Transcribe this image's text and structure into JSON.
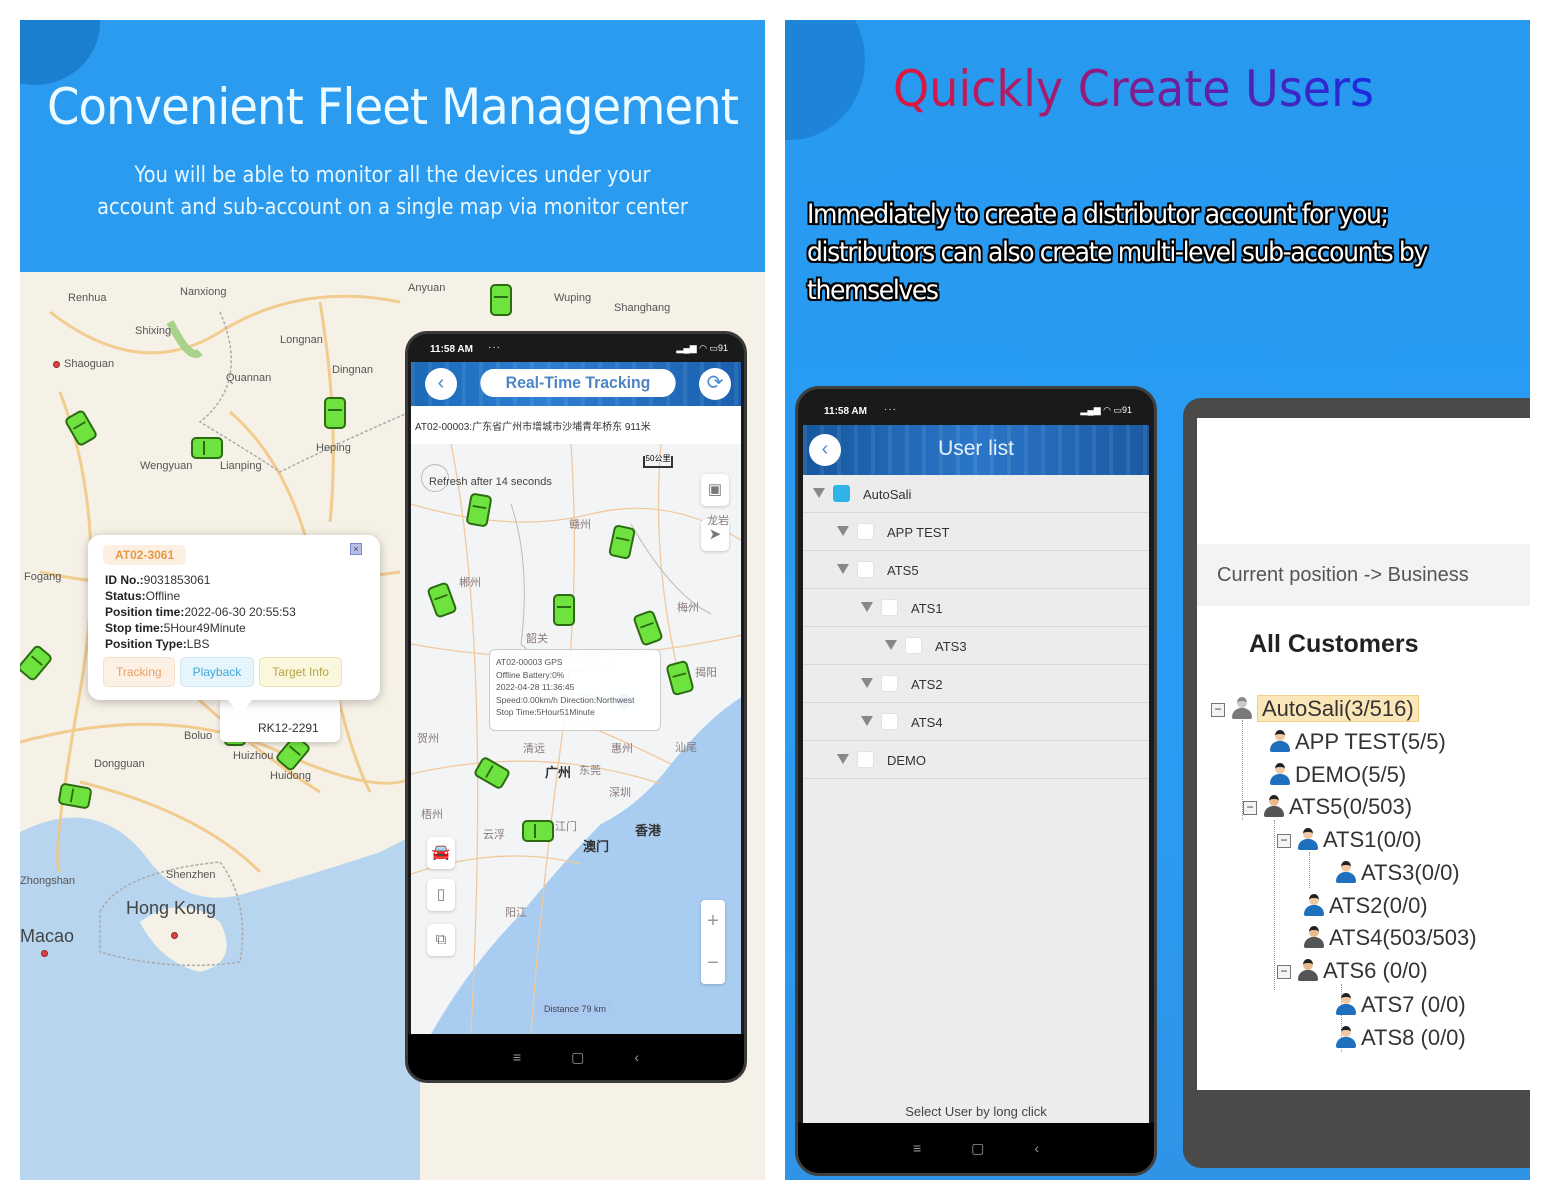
{
  "left": {
    "title": "Convenient Fleet Management",
    "subtitle_line1": "You will be able to monitor all the devices under your",
    "subtitle_line2": "account and sub-account on a single map via monitor center",
    "map_labels": [
      "Renhua",
      "Nanxiong",
      "Shixing",
      "Longnan",
      "Shaoguan",
      "Quannan",
      "Dingnan",
      "Heping",
      "Wengyuan",
      "Lianping",
      "Fogang",
      "Boluo",
      "Huizhou",
      "Huidong",
      "Dongguan",
      "Zhongshan",
      "Shenzhen",
      "Hong Kong",
      "Macao",
      "Anyuan",
      "Wuping",
      "Shanghang"
    ],
    "info_popup": {
      "device": "AT02-3061",
      "id_label": "ID No.:",
      "id_value": "9031853061",
      "status_label": "Status:",
      "status_value": "Offline",
      "position_time_label": "Position time:",
      "position_time_value": "2022-06-30 20:55:53",
      "stop_time_label": "Stop time:",
      "stop_time_value": "5Hour49Minute",
      "position_type_label": "Position Type:",
      "position_type_value": "LBS",
      "buttons": [
        "Tracking",
        "Playback",
        "Target Info"
      ]
    },
    "second_popup_text": "RK12-2291",
    "phone": {
      "time": "11:58 AM",
      "dots": "···",
      "battery": "91",
      "title": "Real-Time Tracking",
      "address": "AT02-00003:广东省广州市增城市沙埔青年桥东 911米",
      "refresh_text": "Refresh after 14 seconds",
      "scale": "50公里",
      "gps_popup": {
        "line1": "AT02-00003  GPS",
        "line2": "Offline Battery:0%",
        "line3": "2022-04-28 11:36:45",
        "line4": "Speed:0.00km/h Direction:Northwest",
        "line5": "Stop Time:5Hour51Minute"
      },
      "map_labels": [
        "赣州",
        "郴州",
        "龙岩",
        "梅州",
        "韶关",
        "清远",
        "惠州",
        "汕尾",
        "广州",
        "东莞",
        "深圳",
        "香港",
        "澳门",
        "江门",
        "云浮",
        "梧州",
        "阳江",
        "贺州",
        "揭阳"
      ],
      "distance": "Distance 79 km",
      "zoom_in": "+",
      "zoom_out": "−"
    }
  },
  "right": {
    "title": "Quickly Create Users",
    "description": "Immediately to create a distributor account for you; distributors can also create multi-level sub-accounts by themselves",
    "phone": {
      "time": "11:58 AM",
      "dots": "···",
      "battery": "91",
      "title": "User list",
      "users": [
        {
          "name": "AutoSali",
          "level": 0,
          "checked": true
        },
        {
          "name": "APP TEST",
          "level": 1,
          "checked": false
        },
        {
          "name": "ATS5",
          "level": 1,
          "checked": false
        },
        {
          "name": "ATS1",
          "level": 2,
          "checked": false
        },
        {
          "name": "ATS3",
          "level": 3,
          "checked": false
        },
        {
          "name": "ATS2",
          "level": 2,
          "checked": false
        },
        {
          "name": "ATS4",
          "level": 2,
          "checked": false
        },
        {
          "name": "DEMO",
          "level": 1,
          "checked": false
        }
      ],
      "footer": "Select User by long click"
    },
    "web": {
      "breadcrumb": "Current position -> Business",
      "heading": "All Customers",
      "tree": [
        {
          "name": "AutoSali(3/516)",
          "level": 0,
          "icon": "admin",
          "expanded": true,
          "selected": true
        },
        {
          "name": "APP TEST(5/5)",
          "level": 1,
          "icon": "user"
        },
        {
          "name": "DEMO(5/5)",
          "level": 1,
          "icon": "user"
        },
        {
          "name": "ATS5(0/503)",
          "level": 1,
          "icon": "group",
          "expanded": true
        },
        {
          "name": "ATS1(0/0)",
          "level": 2,
          "icon": "user",
          "expanded": true
        },
        {
          "name": "ATS3(0/0)",
          "level": 3,
          "icon": "user"
        },
        {
          "name": "ATS2(0/0)",
          "level": 2,
          "icon": "user"
        },
        {
          "name": "ATS4(503/503)",
          "level": 2,
          "icon": "group"
        },
        {
          "name": "ATS6 (0/0)",
          "level": 2,
          "icon": "group",
          "expanded": true
        },
        {
          "name": "ATS7 (0/0)",
          "level": 3,
          "icon": "user"
        },
        {
          "name": "ATS8 (0/0)",
          "level": 3,
          "icon": "user"
        }
      ]
    }
  }
}
